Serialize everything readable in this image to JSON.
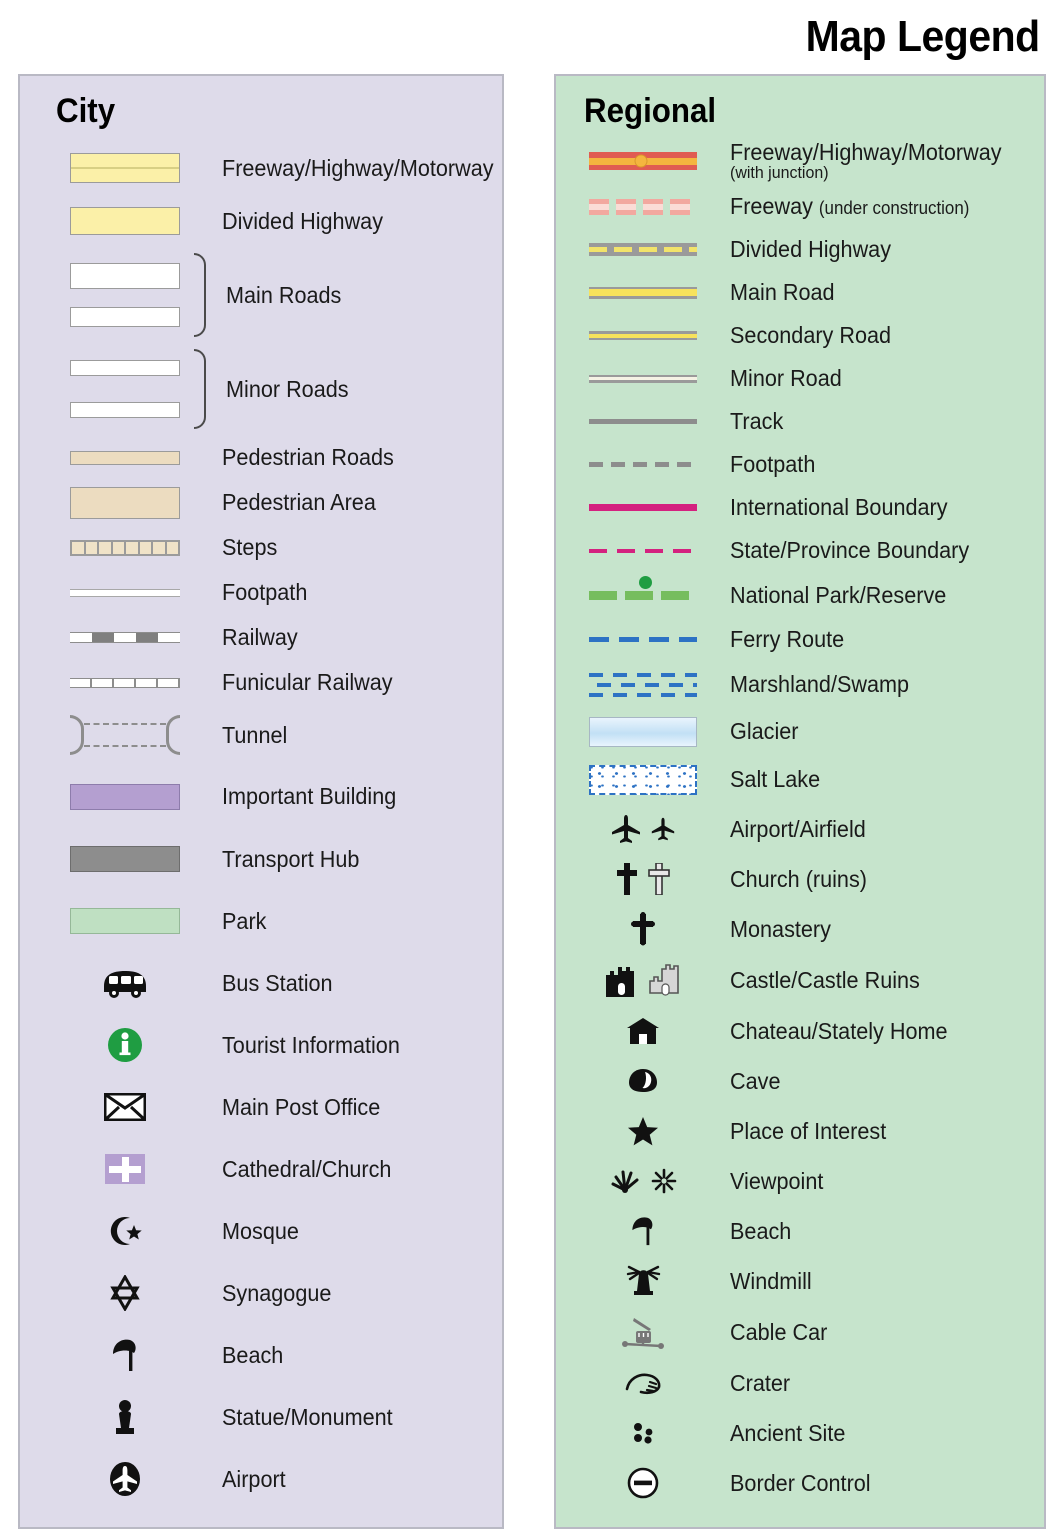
{
  "title": "Map Legend",
  "city": {
    "heading": "City",
    "items": [
      {
        "label": "Freeway/Highway/Motorway",
        "symbol": "freeway-swatch"
      },
      {
        "label": "Divided Highway",
        "symbol": "divided-highway-swatch"
      },
      {
        "label": "Main Roads",
        "symbol": "main-roads-swatch-pair"
      },
      {
        "label": "Minor Roads",
        "symbol": "minor-roads-swatch-pair"
      },
      {
        "label": "Pedestrian Roads",
        "symbol": "pedestrian-road-swatch"
      },
      {
        "label": "Pedestrian Area",
        "symbol": "pedestrian-area-swatch"
      },
      {
        "label": "Steps",
        "symbol": "steps-swatch"
      },
      {
        "label": "Footpath",
        "symbol": "footpath-line"
      },
      {
        "label": "Railway",
        "symbol": "railway-line"
      },
      {
        "label": "Funicular Railway",
        "symbol": "funicular-railway-line"
      },
      {
        "label": "Tunnel",
        "symbol": "tunnel-bracket"
      },
      {
        "label": "Important Building",
        "symbol": "important-building-swatch"
      },
      {
        "label": "Transport Hub",
        "symbol": "transport-hub-swatch"
      },
      {
        "label": "Park",
        "symbol": "park-swatch"
      },
      {
        "label": "Bus Station",
        "symbol": "bus-icon"
      },
      {
        "label": "Tourist Information",
        "symbol": "information-icon"
      },
      {
        "label": "Main Post Office",
        "symbol": "envelope-icon"
      },
      {
        "label": "Cathedral/Church",
        "symbol": "cross-on-purple-icon"
      },
      {
        "label": "Mosque",
        "symbol": "crescent-star-icon"
      },
      {
        "label": "Synagogue",
        "symbol": "star-of-david-icon"
      },
      {
        "label": "Beach",
        "symbol": "beach-umbrella-icon"
      },
      {
        "label": "Statue/Monument",
        "symbol": "statue-icon"
      },
      {
        "label": "Airport",
        "symbol": "airport-circle-icon"
      }
    ]
  },
  "regional": {
    "heading": "Regional",
    "items": [
      {
        "label": "Freeway/Highway/Motorway",
        "sublabel": "(with junction)",
        "symbol": "freeway-junction-line"
      },
      {
        "label": "Freeway",
        "inline": "(under construction)",
        "symbol": "freeway-under-construction-line"
      },
      {
        "label": "Divided Highway",
        "symbol": "divided-highway-line"
      },
      {
        "label": "Main Road",
        "symbol": "main-road-line"
      },
      {
        "label": "Secondary Road",
        "symbol": "secondary-road-line"
      },
      {
        "label": "Minor Road",
        "symbol": "minor-road-line"
      },
      {
        "label": "Track",
        "symbol": "track-line"
      },
      {
        "label": "Footpath",
        "symbol": "footpath-dashed-line"
      },
      {
        "label": "International Boundary",
        "symbol": "international-boundary-line"
      },
      {
        "label": "State/Province Boundary",
        "symbol": "state-boundary-line"
      },
      {
        "label": "National Park/Reserve",
        "symbol": "national-park-line"
      },
      {
        "label": "Ferry Route",
        "symbol": "ferry-route-line"
      },
      {
        "label": "Marshland/Swamp",
        "symbol": "marshland-pattern"
      },
      {
        "label": "Glacier",
        "symbol": "glacier-swatch"
      },
      {
        "label": "Salt Lake",
        "symbol": "salt-lake-swatch"
      },
      {
        "label": "Airport/Airfield",
        "symbol": "airplane-pair-icon"
      },
      {
        "label": "Church (ruins)",
        "symbol": "cross-pair-icon"
      },
      {
        "label": "Monastery",
        "symbol": "monastery-cross-icon"
      },
      {
        "label": "Castle/Castle Ruins",
        "symbol": "castle-pair-icon"
      },
      {
        "label": "Chateau/Stately Home",
        "symbol": "chateau-icon"
      },
      {
        "label": "Cave",
        "symbol": "cave-icon"
      },
      {
        "label": "Place of Interest",
        "symbol": "star-icon"
      },
      {
        "label": "Viewpoint",
        "symbol": "viewpoint-pair-icon"
      },
      {
        "label": "Beach",
        "symbol": "beach-umbrella-icon"
      },
      {
        "label": "Windmill",
        "symbol": "windmill-icon"
      },
      {
        "label": "Cable Car",
        "symbol": "cable-car-icon"
      },
      {
        "label": "Crater",
        "symbol": "crater-icon"
      },
      {
        "label": "Ancient Site",
        "symbol": "ancient-site-icon"
      },
      {
        "label": "Border Control",
        "symbol": "border-control-icon"
      }
    ]
  },
  "colors": {
    "city_panel_bg": "#dedbea",
    "regional_panel_bg": "#c6e4cc",
    "highway_yellow": "#fbf0a8",
    "pedestrian_beige": "#ecdcc0",
    "important_building_purple": "#b49fd0",
    "transport_hub_grey": "#8d8d8d",
    "park_green": "#bfe0c2",
    "freeway_red": "#e05c52",
    "junction_amber": "#f4b53f",
    "boundary_magenta": "#d4217f",
    "park_line_green": "#76bd5e",
    "ferry_blue": "#2d72c4",
    "info_green": "#1f9d42"
  }
}
